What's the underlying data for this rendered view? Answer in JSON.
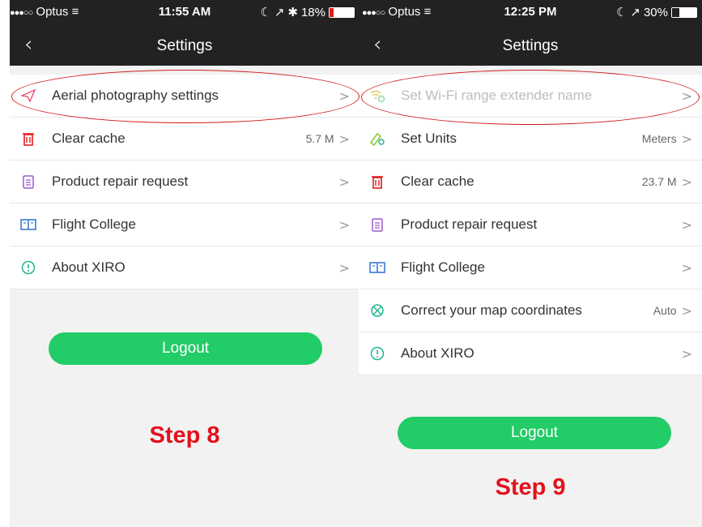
{
  "left": {
    "status": {
      "carrier": "Optus",
      "time": "11:55 AM",
      "battery": "18%",
      "battery_level": 0.18
    },
    "nav": {
      "title": "Settings"
    },
    "rows": [
      {
        "label": "Aerial photography settings",
        "value": "",
        "icon": "paper-plane-icon"
      },
      {
        "label": "Clear cache",
        "value": "5.7 M",
        "icon": "trash-icon"
      },
      {
        "label": "Product repair request",
        "value": "",
        "icon": "clipboard-icon"
      },
      {
        "label": "Flight College",
        "value": "",
        "icon": "book-icon"
      },
      {
        "label": "About XIRO",
        "value": "",
        "icon": "info-icon"
      }
    ],
    "logout": "Logout",
    "step": "Step 8"
  },
  "right": {
    "status": {
      "carrier": "Optus",
      "time": "12:25 PM",
      "battery": "30%",
      "battery_level": 0.3
    },
    "nav": {
      "title": "Settings"
    },
    "rows": [
      {
        "label": "Set Wi-Fi range extender name",
        "value": "",
        "icon": "wifi-icon"
      },
      {
        "label": "Set Units",
        "value": "Meters",
        "icon": "ruler-icon"
      },
      {
        "label": "Clear cache",
        "value": "23.7 M",
        "icon": "trash-icon"
      },
      {
        "label": "Product repair request",
        "value": "",
        "icon": "clipboard-icon"
      },
      {
        "label": "Flight College",
        "value": "",
        "icon": "book-icon"
      },
      {
        "label": "Correct your map coordinates",
        "value": "Auto",
        "icon": "map-pin-icon"
      },
      {
        "label": "About XIRO",
        "value": "",
        "icon": "info-icon"
      }
    ],
    "logout": "Logout",
    "step": "Step 9"
  },
  "colors": {
    "nav_bg": "#222222",
    "accent_green": "#22cc66",
    "step_red": "#e3111b",
    "annotation_red": "#d11a1a"
  }
}
